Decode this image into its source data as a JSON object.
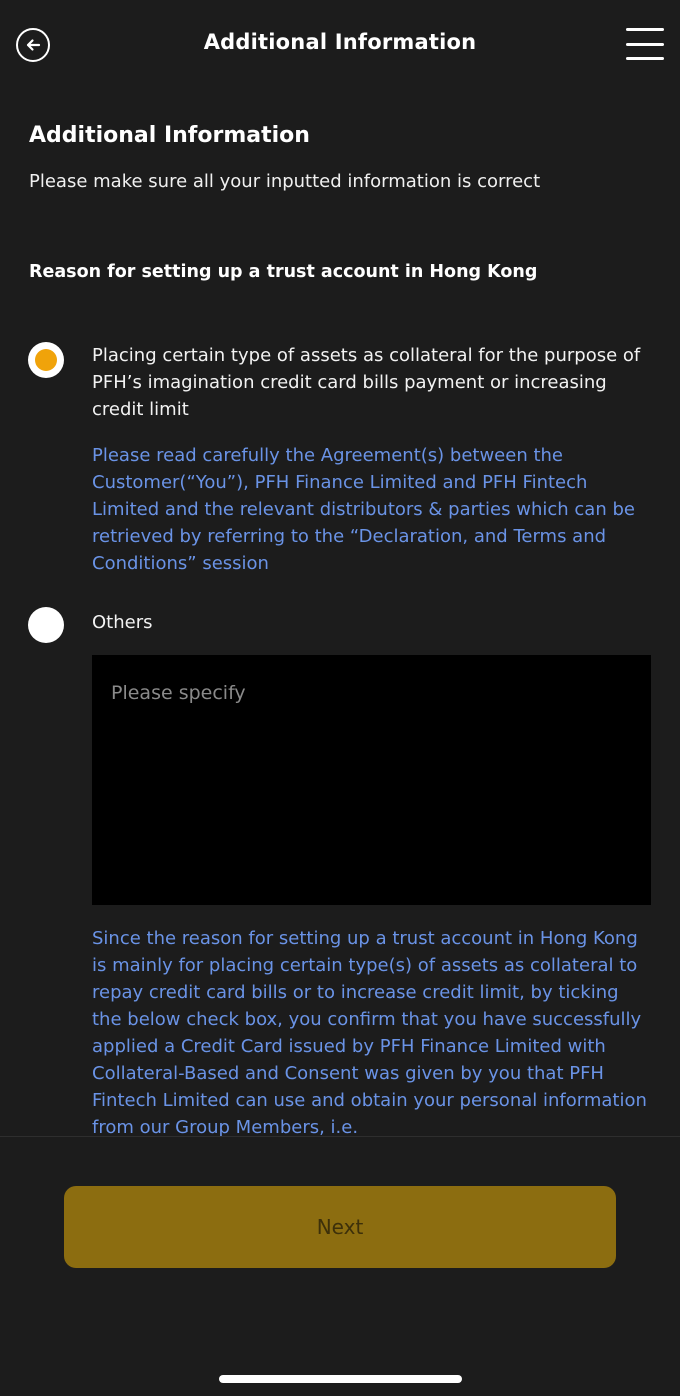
{
  "header": {
    "title": "Additional Information",
    "back_icon": "arrow-left-circle-icon",
    "menu_icon": "hamburger-menu-icon"
  },
  "form": {
    "section_title": "Additional Information",
    "section_subtitle": "Please make sure all your inputted information is correct",
    "question": "Reason for setting up a trust account in Hong Kong",
    "options": [
      {
        "label": "Placing certain type of assets as collateral for the purpose of PFH’s imagination credit card bills payment or increasing credit limit",
        "selected": true,
        "note": "Please read carefully the Agreement(s) between the Customer(“You”), PFH Finance Limited and PFH Fintech Limited and the relevant distributors & parties which can be retrieved by referring to the “Declaration, and Terms and Conditions” session"
      },
      {
        "label": "Others",
        "selected": false
      }
    ],
    "specify_placeholder": "Please specify",
    "specify_value": "",
    "disclaimer": "Since the reason for setting up a trust account in Hong Kong is mainly for placing certain type(s) of assets as collateral to repay credit card bills or to increase credit limit, by ticking the below check box, you confirm that you have successfully applied a Credit Card issued by PFH Finance Limited with Collateral-Based and Consent was given by you that PFH Fintech Limited can use and obtain your personal information from our Group Members, i.e."
  },
  "footer": {
    "next_label": "Next",
    "next_disabled": true
  },
  "colors": {
    "background": "#1c1c1c",
    "accent_radio": "#f0a30a",
    "link_blue": "#6a93e6",
    "button_disabled": "#8c6d10"
  }
}
